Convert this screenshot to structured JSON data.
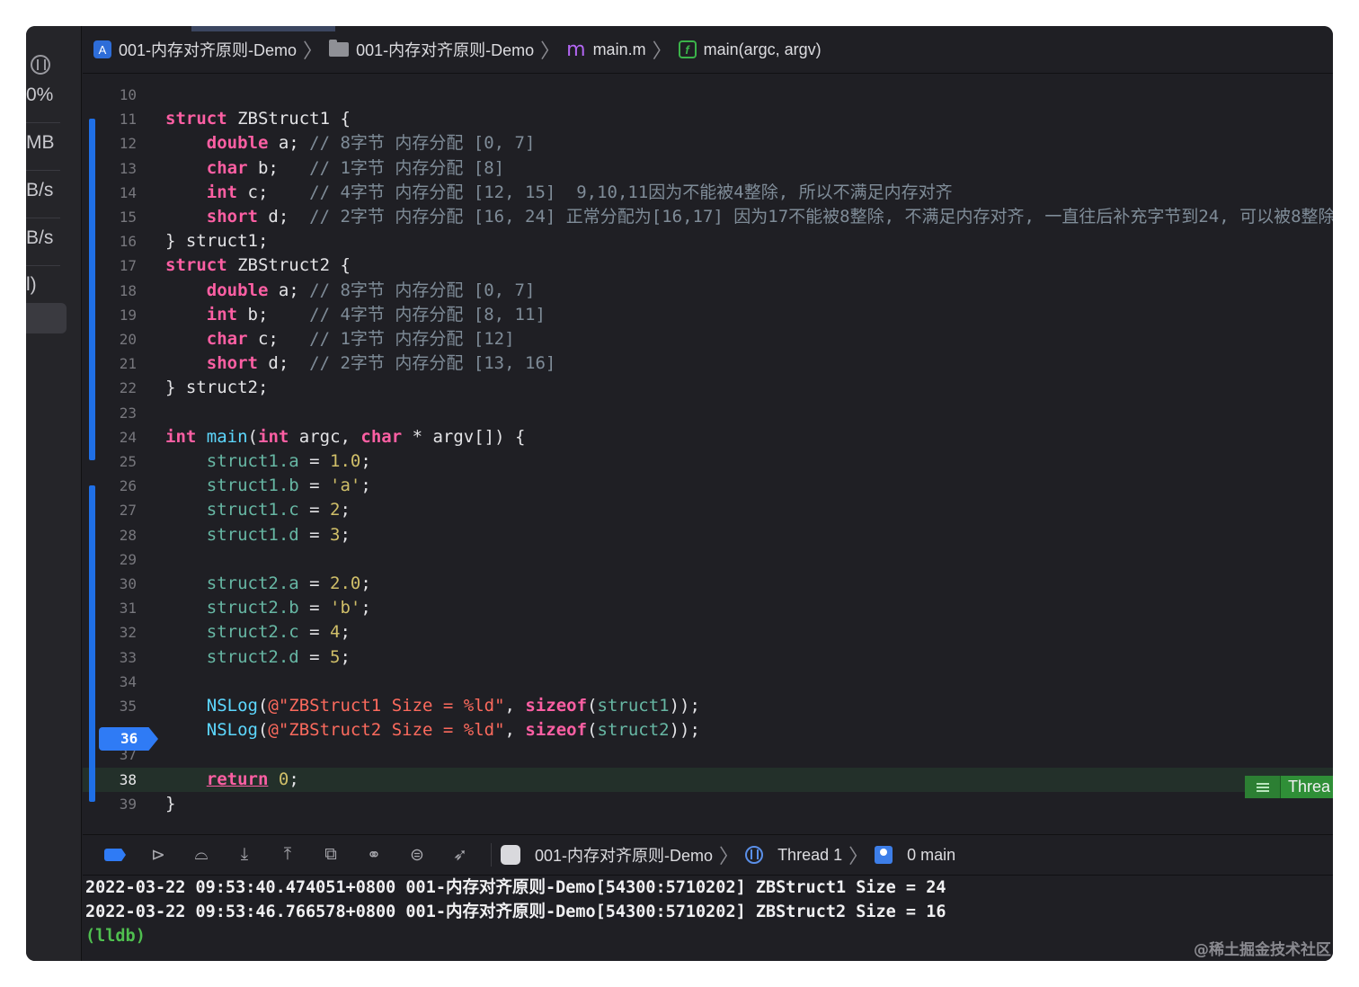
{
  "breadcrumbs": {
    "project": "001-内存对齐原则-Demo",
    "folder": "001-内存对齐原则-Demo",
    "file": "main.m",
    "function": "main(argc, argv)"
  },
  "gauges": [
    "0%",
    "MB",
    "B/s",
    "B/s",
    "l)"
  ],
  "editor": {
    "current_line": 38,
    "breakpoint_line": "36",
    "thread_tag": "Threa",
    "lines": [
      {
        "n": "10",
        "segs": []
      },
      {
        "n": "11",
        "segs": [
          [
            "kw",
            "struct"
          ],
          [
            "t",
            " ZBStruct1 {"
          ]
        ]
      },
      {
        "n": "12",
        "segs": [
          [
            "t",
            "    "
          ],
          [
            "kw",
            "double"
          ],
          [
            "t",
            " a; "
          ],
          [
            "cm",
            "// 8字节 内存分配 [0, 7]"
          ]
        ]
      },
      {
        "n": "13",
        "segs": [
          [
            "t",
            "    "
          ],
          [
            "kw",
            "char"
          ],
          [
            "t",
            " b;   "
          ],
          [
            "cm",
            "// 1字节 内存分配 [8]"
          ]
        ]
      },
      {
        "n": "14",
        "segs": [
          [
            "t",
            "    "
          ],
          [
            "kw",
            "int"
          ],
          [
            "t",
            " c;    "
          ],
          [
            "cm",
            "// 4字节 内存分配 [12, 15]  9,10,11因为不能被4整除, 所以不满足内存对齐"
          ]
        ]
      },
      {
        "n": "15",
        "segs": [
          [
            "t",
            "    "
          ],
          [
            "kw",
            "short"
          ],
          [
            "t",
            " d;  "
          ],
          [
            "cm",
            "// 2字节 内存分配 [16, 24] 正常分配为[16,17] 因为17不能被8整除, 不满足内存对齐, 一直往后补充字节到24, 可以被8整除"
          ]
        ]
      },
      {
        "n": "16",
        "segs": [
          [
            "t",
            "} struct1;"
          ]
        ]
      },
      {
        "n": "17",
        "segs": [
          [
            "kw",
            "struct"
          ],
          [
            "t",
            " ZBStruct2 {"
          ]
        ]
      },
      {
        "n": "18",
        "segs": [
          [
            "t",
            "    "
          ],
          [
            "kw",
            "double"
          ],
          [
            "t",
            " a; "
          ],
          [
            "cm",
            "// 8字节 内存分配 [0, 7]"
          ]
        ]
      },
      {
        "n": "19",
        "segs": [
          [
            "t",
            "    "
          ],
          [
            "kw",
            "int"
          ],
          [
            "t",
            " b;    "
          ],
          [
            "cm",
            "// 4字节 内存分配 [8, 11]"
          ]
        ]
      },
      {
        "n": "20",
        "segs": [
          [
            "t",
            "    "
          ],
          [
            "kw",
            "char"
          ],
          [
            "t",
            " c;   "
          ],
          [
            "cm",
            "// 1字节 内存分配 [12]"
          ]
        ]
      },
      {
        "n": "21",
        "segs": [
          [
            "t",
            "    "
          ],
          [
            "kw",
            "short"
          ],
          [
            "t",
            " d;  "
          ],
          [
            "cm",
            "// 2字节 内存分配 [13, 16]"
          ]
        ]
      },
      {
        "n": "22",
        "segs": [
          [
            "t",
            "} struct2;"
          ]
        ]
      },
      {
        "n": "23",
        "segs": []
      },
      {
        "n": "24",
        "segs": [
          [
            "kw",
            "int"
          ],
          [
            "t",
            " "
          ],
          [
            "decl",
            "main"
          ],
          [
            "t",
            "("
          ],
          [
            "kw",
            "int"
          ],
          [
            "t",
            " argc, "
          ],
          [
            "kw",
            "char"
          ],
          [
            "t",
            " * argv[]) {"
          ]
        ]
      },
      {
        "n": "25",
        "segs": [
          [
            "t",
            "    "
          ],
          [
            "prop",
            "struct1.a"
          ],
          [
            "t",
            " = "
          ],
          [
            "num",
            "1.0"
          ],
          [
            "t",
            ";"
          ]
        ]
      },
      {
        "n": "26",
        "segs": [
          [
            "t",
            "    "
          ],
          [
            "prop",
            "struct1.b"
          ],
          [
            "t",
            " = "
          ],
          [
            "num",
            "'a'"
          ],
          [
            "t",
            ";"
          ]
        ]
      },
      {
        "n": "27",
        "segs": [
          [
            "t",
            "    "
          ],
          [
            "prop",
            "struct1.c"
          ],
          [
            "t",
            " = "
          ],
          [
            "num",
            "2"
          ],
          [
            "t",
            ";"
          ]
        ]
      },
      {
        "n": "28",
        "segs": [
          [
            "t",
            "    "
          ],
          [
            "prop",
            "struct1.d"
          ],
          [
            "t",
            " = "
          ],
          [
            "num",
            "3"
          ],
          [
            "t",
            ";"
          ]
        ]
      },
      {
        "n": "29",
        "segs": []
      },
      {
        "n": "30",
        "segs": [
          [
            "t",
            "    "
          ],
          [
            "prop",
            "struct2.a"
          ],
          [
            "t",
            " = "
          ],
          [
            "num",
            "2.0"
          ],
          [
            "t",
            ";"
          ]
        ]
      },
      {
        "n": "31",
        "segs": [
          [
            "t",
            "    "
          ],
          [
            "prop",
            "struct2.b"
          ],
          [
            "t",
            " = "
          ],
          [
            "num",
            "'b'"
          ],
          [
            "t",
            ";"
          ]
        ]
      },
      {
        "n": "32",
        "segs": [
          [
            "t",
            "    "
          ],
          [
            "prop",
            "struct2.c"
          ],
          [
            "t",
            " = "
          ],
          [
            "num",
            "4"
          ],
          [
            "t",
            ";"
          ]
        ]
      },
      {
        "n": "33",
        "segs": [
          [
            "t",
            "    "
          ],
          [
            "prop",
            "struct2.d"
          ],
          [
            "t",
            " = "
          ],
          [
            "num",
            "5"
          ],
          [
            "t",
            ";"
          ]
        ]
      },
      {
        "n": "34",
        "segs": []
      },
      {
        "n": "35",
        "segs": [
          [
            "t",
            "    "
          ],
          [
            "decl",
            "NSLog"
          ],
          [
            "t",
            "("
          ],
          [
            "str",
            "@\"ZBStruct1 Size = %ld\""
          ],
          [
            "t",
            ", "
          ],
          [
            "kw",
            "sizeof"
          ],
          [
            "t",
            "("
          ],
          [
            "prop",
            "struct1"
          ],
          [
            "t",
            "));"
          ]
        ]
      },
      {
        "n": "36",
        "segs": [
          [
            "t",
            "    "
          ],
          [
            "decl",
            "NSLog"
          ],
          [
            "t",
            "("
          ],
          [
            "str",
            "@\"ZBStruct2 Size = %ld\""
          ],
          [
            "t",
            ", "
          ],
          [
            "kw",
            "sizeof"
          ],
          [
            "t",
            "("
          ],
          [
            "prop",
            "struct2"
          ],
          [
            "t",
            "));"
          ]
        ]
      },
      {
        "n": "37",
        "segs": []
      },
      {
        "n": "38",
        "segs": [
          [
            "t",
            "    "
          ],
          [
            "ret",
            "return"
          ],
          [
            "t",
            " "
          ],
          [
            "num",
            "0"
          ],
          [
            "t",
            ";"
          ]
        ]
      },
      {
        "n": "39",
        "segs": [
          [
            "t",
            "}"
          ]
        ]
      }
    ]
  },
  "debugbar": {
    "target": "001-内存对齐原则-Demo",
    "thread": "Thread 1",
    "frame": "0 main",
    "icons": [
      "breakpoint-toggle-icon",
      "continue-icon",
      "step-over-icon",
      "step-into-icon",
      "step-out-icon",
      "debug-view-hierarchy-icon",
      "memory-graph-icon",
      "environment-overrides-icon",
      "simulate-location-icon"
    ]
  },
  "console": {
    "lines": [
      "2022-03-22 09:53:40.474051+0800 001-内存对齐原则-Demo[54300:5710202] ZBStruct1 Size = 24",
      "2022-03-22 09:53:46.766578+0800 001-内存对齐原则-Demo[54300:5710202] ZBStruct2 Size = 16"
    ],
    "prompt": "(lldb)"
  },
  "watermark": "@稀土掘金技术社区",
  "colors": {
    "keyword": "#fc5fa3",
    "comment": "#7f8c98",
    "number": "#d0bf69",
    "string": "#fc6a5d",
    "property": "#67b7a4",
    "declaration": "#5dd8ff",
    "breakpoint": "#2f7bf5",
    "current_line_bg": "#23302a"
  }
}
